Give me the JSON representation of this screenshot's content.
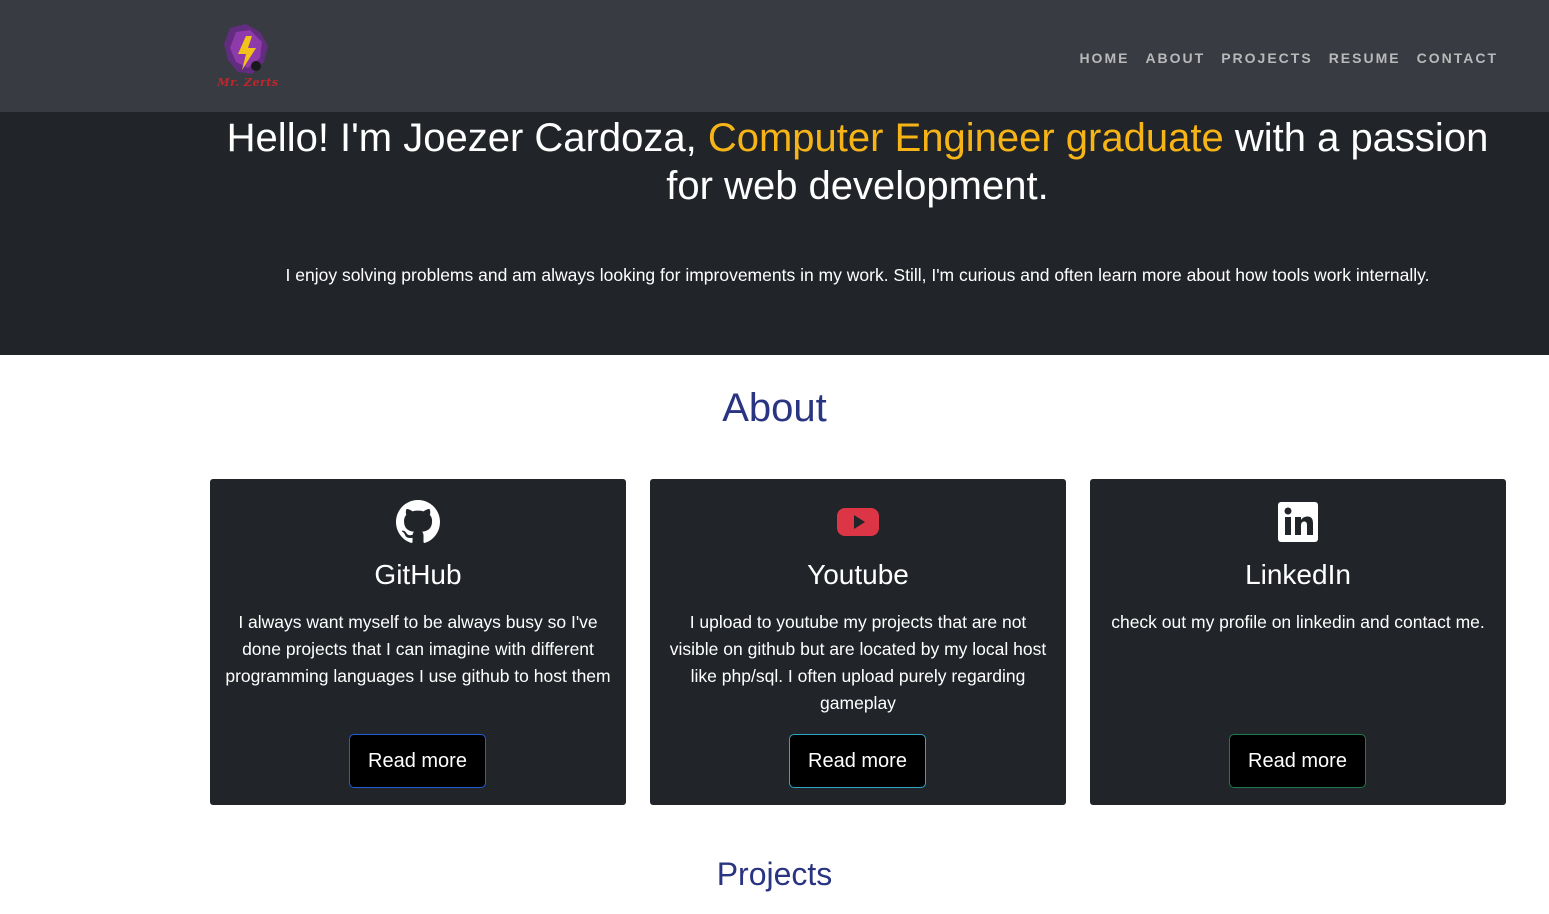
{
  "nav": {
    "logo_text": "Mr. Zerts",
    "links": [
      {
        "label": "HOME"
      },
      {
        "label": "ABOUT"
      },
      {
        "label": "PROJECTS"
      },
      {
        "label": "RESUME"
      },
      {
        "label": "CONTACT"
      }
    ]
  },
  "hero": {
    "title_before": "Hello! I'm Joezer Cardoza, ",
    "title_accent": "Computer Engineer graduate",
    "title_after": " with a passion for web development.",
    "subtitle": "I enjoy solving problems and am always looking for improvements in my work. Still, I'm curious and often learn more about how tools work internally."
  },
  "about": {
    "title": "About",
    "cards": [
      {
        "icon": "github-icon",
        "title": "GitHub",
        "text": "I always want myself to be always busy so I've done projects that I can imagine with different programming languages I use github to host them",
        "button": "Read more",
        "button_border": "#1f5fd6"
      },
      {
        "icon": "youtube-icon",
        "title": "Youtube",
        "text": "I upload to youtube my projects that are not visible on github but are located by my local host like php/sql. I often upload purely regarding gameplay",
        "button": "Read more",
        "button_border": "#2fa4c4"
      },
      {
        "icon": "linkedin-icon",
        "title": "LinkedIn",
        "text": "check out my profile on linkedin and contact me.",
        "button": "Read more",
        "button_border": "#1d7a4a"
      }
    ]
  },
  "projects": {
    "title": "Projects"
  },
  "colors": {
    "navbar": "#383b41",
    "hero": "#212429",
    "accent": "#f6b417",
    "section_title": "#2a3582",
    "youtube_red": "#dc3545"
  }
}
